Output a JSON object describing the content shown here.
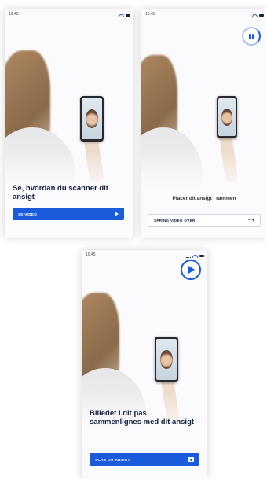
{
  "screens": [
    {
      "time": "10:45",
      "heading": "Se, hvordan du scanner dit ansigt",
      "button_label": "SE VIDEO",
      "button_icon": "play-triangle-icon"
    },
    {
      "time": "10:45",
      "subtext": "Placer dit ansigt i rammen",
      "button_label": "SPRING VIDEO OVER",
      "button_icon": "skip-arrow-icon",
      "control_icon": "pause-icon"
    },
    {
      "time": "10:45",
      "heading": "Billedet i dit pas sammenlignes med dit ansigt",
      "button_label": "SCAN DIT ANSIGT",
      "button_icon": "camera-icon",
      "control_icon": "play-icon"
    }
  ],
  "colors": {
    "primary": "#1a5bdc",
    "heading_text": "#16213e",
    "background": "#fbfbfd"
  }
}
